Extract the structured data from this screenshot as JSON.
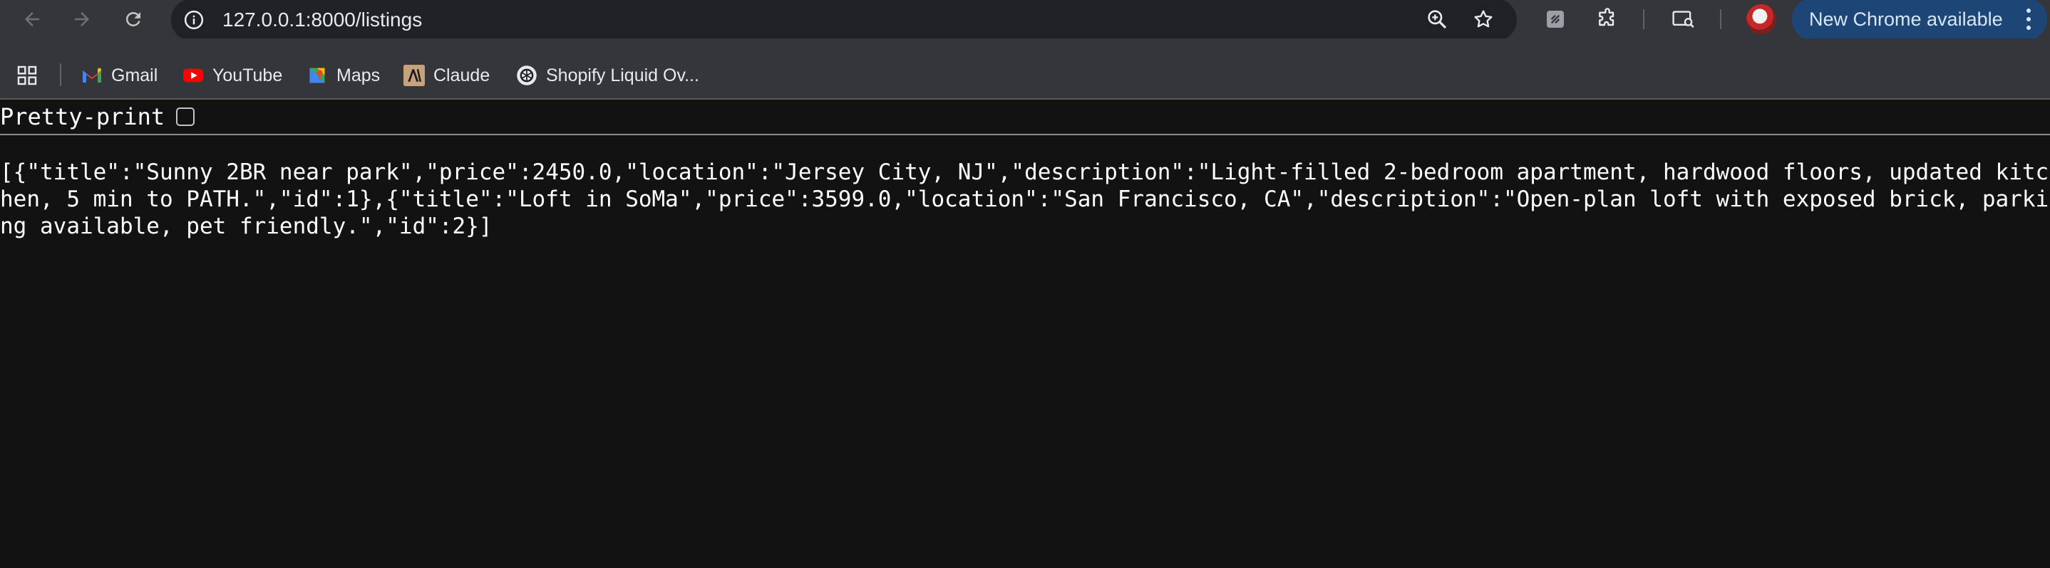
{
  "browser": {
    "url": "127.0.0.1:8000/listings",
    "update_label": "New Chrome available",
    "bookmarks": [
      {
        "label": "Gmail",
        "icon": "gmail-icon"
      },
      {
        "label": "YouTube",
        "icon": "youtube-icon"
      },
      {
        "label": "Maps",
        "icon": "maps-icon"
      },
      {
        "label": "Claude",
        "icon": "claude-icon"
      },
      {
        "label": "Shopify Liquid Ov...",
        "icon": "openai-icon"
      }
    ]
  },
  "page": {
    "pretty_print_label": "Pretty-print",
    "pretty_print_checked": false,
    "json_text": "[{\"title\":\"Sunny 2BR near park\",\"price\":2450.0,\"location\":\"Jersey City, NJ\",\"description\":\"Light-filled 2-bedroom apartment, hardwood floors, updated kitchen, 5 min to PATH.\",\"id\":1},{\"title\":\"Loft in SoMa\",\"price\":3599.0,\"location\":\"San Francisco, CA\",\"description\":\"Open-plan loft with exposed brick, parking available, pet friendly.\",\"id\":2}]"
  },
  "colors": {
    "toolbar_bg": "#35363a",
    "omnibox_bg": "#202124",
    "page_bg": "#121212",
    "update_pill_bg": "#1d4575"
  }
}
